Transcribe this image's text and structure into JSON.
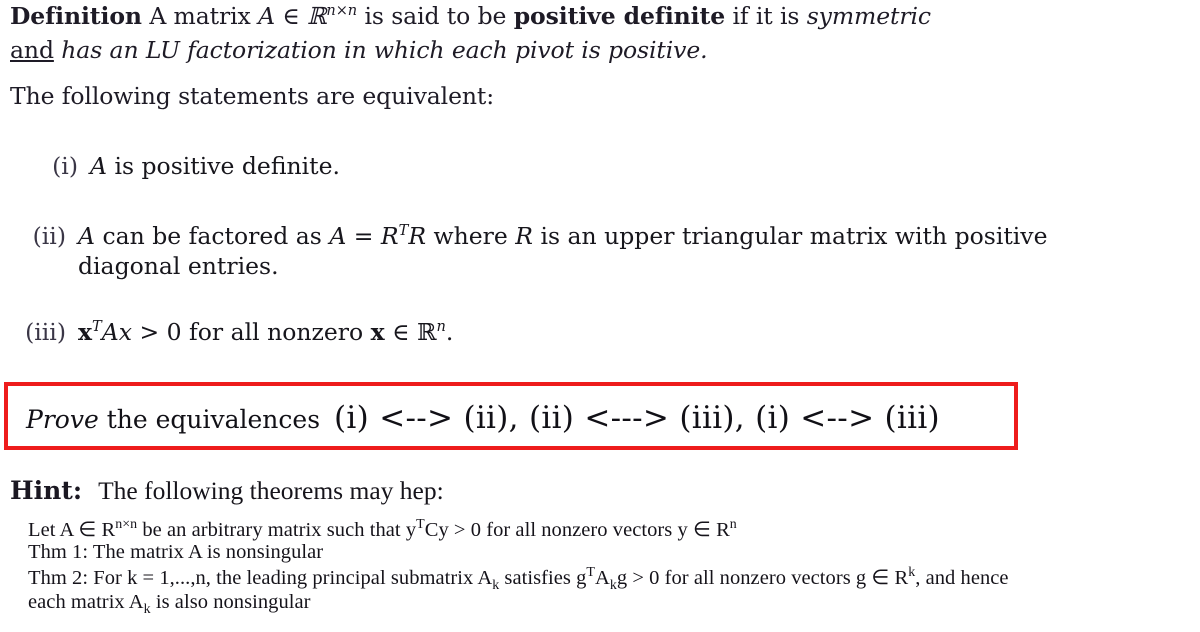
{
  "document": {
    "type": "scanned-textbook-exercise",
    "definition": {
      "label": "Definition",
      "line1_a": "A matrix ",
      "line1_math": "A ∈ ℝ",
      "line1_exp": "n×n",
      "line1_b": " is said to be ",
      "line1_bold": "positive definite",
      "line1_c": " if it is ",
      "line1_italic": "symmetric",
      "line2_underline": "and",
      "line2_italic": " has an LU factorization in which each pivot is positive."
    },
    "equivalence_intro": "The following statements are equivalent:",
    "statements": [
      {
        "num": "(i)",
        "text_a": "A",
        "text_b": " is positive definite."
      },
      {
        "num": "(ii)",
        "line1_a": "A",
        "line1_b": " can be factored as ",
        "line1_math": "A = R",
        "line1_exp": "T",
        "line1_math2": "R",
        "line1_c": " where ",
        "line1_math3": "R",
        "line1_d": " is an upper triangular matrix with positive",
        "line2": "diagonal entries."
      },
      {
        "num": "(iii)",
        "math_x": "x",
        "math_T": "T",
        "math_Ax": "Ax",
        "text_a": " > 0 for all nonzero ",
        "math_x2": "x",
        "text_b": " ∈ ℝ",
        "exp_n": "n",
        "text_c": "."
      }
    ],
    "prove_box": {
      "border_color": "#ee1c1c",
      "lead_italic": "Prove",
      "lead_rest": " the equivalences",
      "equivalences": "(i) <--> (ii), (ii) <---> (iii), (i) <--> (iii)"
    },
    "hint": {
      "label": "Hint:",
      "heading": "The following theorems may hep:",
      "lines": [
        {
          "a": "Let A ∈ R",
          "sup": "n×n",
          "b": " be an arbitrary matrix such that y",
          "sup2": "T",
          "c": "Cy > 0 for all nonzero vectors y ∈ R",
          "sup3": "n",
          "d": ""
        },
        {
          "a": "Thm 1: The matrix A is nonsingular"
        },
        {
          "a": "Thm 2: For  k = 1,...,n, the leading principal submatrix A",
          "sub": "k",
          "b": " satisfies g",
          "sup": "T",
          "c": "A",
          "sub2": "k",
          "d": "g > 0 for all nonzero vectors g ∈ R",
          "sup2": "k",
          "e": ", and hence"
        },
        {
          "a": "each matrix A",
          "sub": "k",
          "b": " is also nonsingular"
        }
      ]
    }
  }
}
